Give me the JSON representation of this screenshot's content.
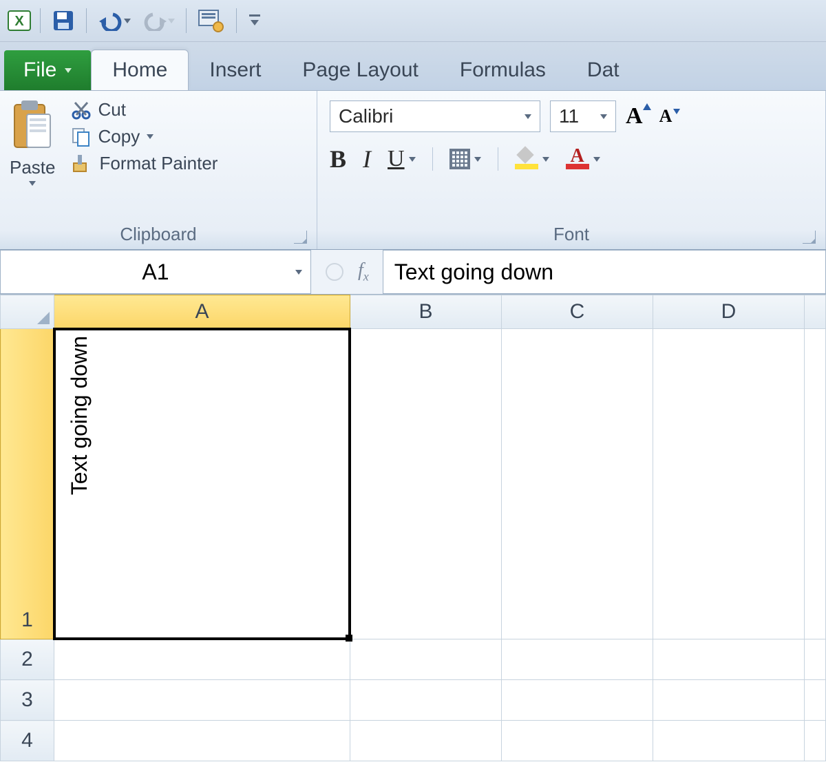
{
  "tabs": {
    "file": "File",
    "home": "Home",
    "insert": "Insert",
    "page_layout": "Page Layout",
    "formulas": "Formulas",
    "data": "Dat"
  },
  "clipboard": {
    "paste": "Paste",
    "cut": "Cut",
    "copy": "Copy",
    "format_painter": "Format Painter",
    "group_label": "Clipboard"
  },
  "font": {
    "name": "Calibri",
    "size": "11",
    "bold": "B",
    "italic": "I",
    "underline": "U",
    "fontcolor_glyph": "A",
    "grow": "A",
    "shrink": "A",
    "group_label": "Font"
  },
  "namebox": "A1",
  "fx_label": "f",
  "fx_sub": "x",
  "formula_bar": "Text going down",
  "columns": {
    "A": "A",
    "B": "B",
    "C": "C",
    "D": "D"
  },
  "rows": {
    "r1": "1",
    "r2": "2",
    "r3": "3",
    "r4": "4"
  },
  "cells": {
    "A1": "Text going down"
  }
}
